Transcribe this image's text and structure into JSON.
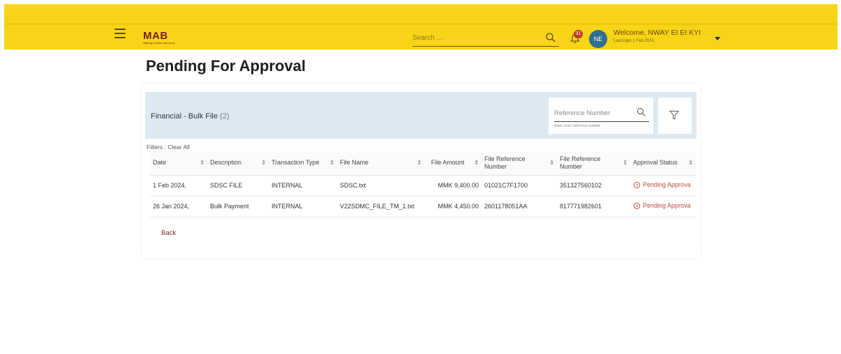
{
  "header": {
    "brand": "MAB",
    "tagline": "Making a better tomorrow",
    "search_placeholder": "Search ...",
    "notification_count": "31",
    "avatar_initials": "NE",
    "welcome": "Welcome, NWAY EI EI KYI",
    "last_login": "Last login 1 Feb 2024,"
  },
  "page": {
    "title": "Pending For Approval"
  },
  "panel": {
    "title": "Financial - Bulk File",
    "count": "(2)",
    "ref_placeholder": "Reference Number",
    "ref_hint": "Enter exact reference number",
    "filters_label": "Filters :",
    "clear_all": "Clear All",
    "back": "Back"
  },
  "table": {
    "columns": [
      "Date",
      "Description",
      "Transaction Type",
      "File Name",
      "File Amount",
      "File Reference Number",
      "File Reference Number",
      "Approval Status"
    ],
    "rows": [
      [
        "1 Feb 2024,",
        "SDSC FILE",
        "INTERNAL",
        "SDSC.txt",
        "MMK 9,400.00",
        "01021C7F1700",
        "351327560102",
        "Pending Approva"
      ],
      [
        "26 Jan 2024,",
        "Bulk Payment",
        "INTERNAL",
        "V22SDMC_FILE_TM_1.txt",
        "MMK 4,450.00",
        "2601178051AA",
        "817771982601",
        "Pending Approva"
      ]
    ]
  },
  "colors": {
    "header_bg": "#f7d417",
    "brand": "#7a1f17",
    "panel_header_bg": "#dde9f2",
    "status": "#b84a3a",
    "avatar_bg": "#2f6f8f",
    "badge": "#c0392b"
  },
  "icons": {
    "menu": "hamburger-icon",
    "search": "search-icon",
    "notifications": "bell-icon",
    "filter": "funnel-icon",
    "sort": "sort-icon",
    "status": "history-clock-icon"
  }
}
